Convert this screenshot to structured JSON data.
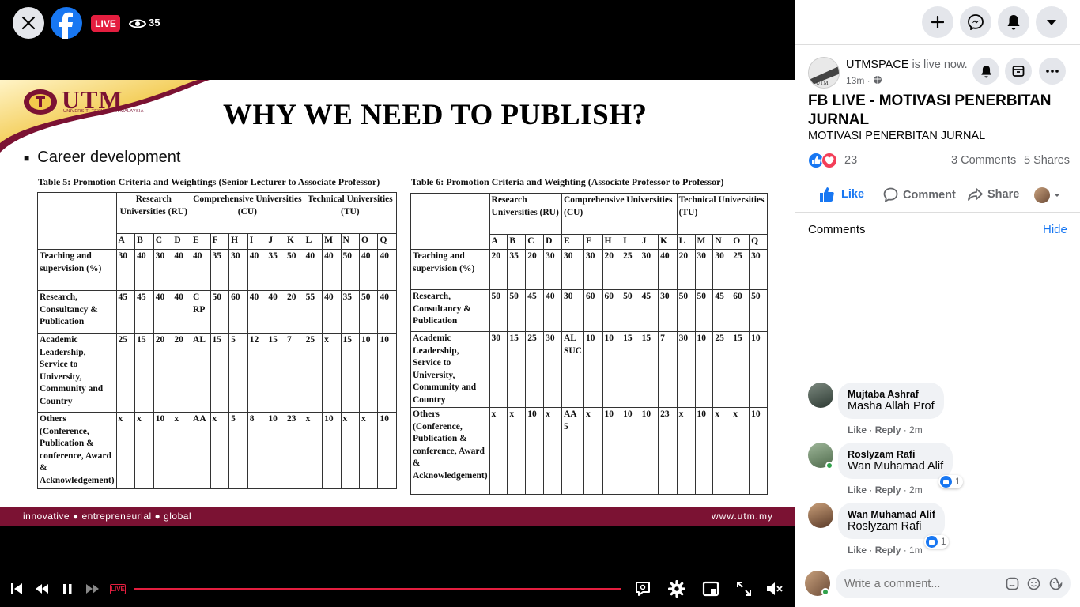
{
  "top": {
    "live": "LIVE",
    "viewers": "35"
  },
  "slide": {
    "logo_text": "UTM",
    "logo_sub": "UNIVERSITI TEKNOLOGI MALAYSIA",
    "title": "WHY WE NEED TO PUBLISH?",
    "bullet": "Career development",
    "footer_left": "innovative ● entrepreneurial ● global",
    "footer_right": "www.utm.my",
    "table5": {
      "caption": "Table 5: Promotion Criteria and Weightings (Senior Lecturer to Associate Professor)",
      "groups": [
        "Research Universities (RU)",
        "Comprehensive Universities (CU)",
        "Technical Universities (TU)"
      ],
      "cols": [
        "A",
        "B",
        "C",
        "D",
        "E",
        "F",
        "H",
        "I",
        "J",
        "K",
        "L",
        "M",
        "N",
        "O",
        "Q"
      ],
      "rows": [
        {
          "label": "Teaching and supervision (%)",
          "vals": [
            "30",
            "40",
            "30",
            "40",
            "40",
            "35",
            "30",
            "40",
            "35",
            "50",
            "40",
            "40",
            "50",
            "40",
            "40"
          ]
        },
        {
          "label": "Research, Consultancy & Publication",
          "vals": [
            "45",
            "45",
            "40",
            "40",
            "C RP",
            "50",
            "60",
            "40",
            "40",
            "20",
            "55",
            "40",
            "35",
            "50",
            "40"
          ]
        },
        {
          "label": "Academic Leadership, Service to University, Community and Country",
          "vals": [
            "25",
            "15",
            "20",
            "20",
            "AL",
            "15",
            "5",
            "12",
            "15",
            "7",
            "25",
            "x",
            "15",
            "10",
            "10"
          ]
        },
        {
          "label": "Others (Conference, Publication & conference, Award & Acknowledgement)",
          "vals": [
            "x",
            "x",
            "10",
            "x",
            "AA",
            "x",
            "5",
            "8",
            "10",
            "23",
            "x",
            "10",
            "x",
            "x",
            "10"
          ]
        }
      ]
    },
    "table6": {
      "caption": "Table 6: Promotion Criteria and Weighting (Associate Professor to Professor)",
      "groups": [
        "Research Universities (RU)",
        "Comprehensive Universities (CU)",
        "Technical Universities (TU)"
      ],
      "cols": [
        "A",
        "B",
        "C",
        "D",
        "E",
        "F",
        "H",
        "I",
        "J",
        "K",
        "L",
        "M",
        "N",
        "O",
        "Q"
      ],
      "rows": [
        {
          "label": "Teaching and supervision (%)",
          "vals": [
            "20",
            "35",
            "20",
            "30",
            "30",
            "30",
            "20",
            "25",
            "30",
            "40",
            "20",
            "30",
            "30",
            "25",
            "30"
          ]
        },
        {
          "label": "Research, Consultancy & Publication",
          "vals": [
            "50",
            "50",
            "45",
            "40",
            "30",
            "60",
            "60",
            "50",
            "45",
            "30",
            "50",
            "50",
            "45",
            "60",
            "50"
          ]
        },
        {
          "label": "Academic Leadership, Service to University, Community and Country",
          "vals": [
            "30",
            "15",
            "25",
            "30",
            "AL SUC",
            "10",
            "10",
            "15",
            "15",
            "7",
            "30",
            "10",
            "25",
            "15",
            "10"
          ]
        },
        {
          "label": "Others (Conference, Publication & conference, Award & Acknowledgement)",
          "vals": [
            "x",
            "x",
            "10",
            "x",
            "AA 5",
            "x",
            "10",
            "10",
            "10",
            "23",
            "x",
            "10",
            "x",
            "x",
            "10"
          ]
        }
      ]
    }
  },
  "controls": {
    "live": "LIVE",
    "progress": 1.0
  },
  "post": {
    "page": "UTMSPACE",
    "status": "is live now.",
    "time": "13m ·",
    "title": "FB LIVE - MOTIVASI PENERBITAN JURNAL",
    "subtitle": "MOTIVASI PENERBITAN JURNAL",
    "reactions": "23",
    "comments": "3 Comments",
    "shares": "5 Shares",
    "like": "Like",
    "comment": "Comment",
    "share": "Share"
  },
  "comments_header": {
    "title": "Comments",
    "hide": "Hide"
  },
  "comments": [
    {
      "name": "Mujtaba Ashraf",
      "text": "Masha Allah Prof",
      "like": "Like",
      "reply": "Reply",
      "time": "2m",
      "reactions": ""
    },
    {
      "name": "Roslyzam Rafi",
      "text": "Wan Muhamad Alif",
      "like": "Like",
      "reply": "Reply",
      "time": "2m",
      "reactions": "1"
    },
    {
      "name": "Wan Muhamad Alif",
      "text": "Roslyzam Rafi",
      "like": "Like",
      "reply": "Reply",
      "time": "1m",
      "reactions": "1"
    }
  ],
  "composer": {
    "placeholder": "Write a comment..."
  },
  "colors": {
    "fb_blue": "#1877f2",
    "live_red": "#e41e3f",
    "utm_maroon": "#7b1233",
    "utm_gold": "#f2c94c"
  }
}
